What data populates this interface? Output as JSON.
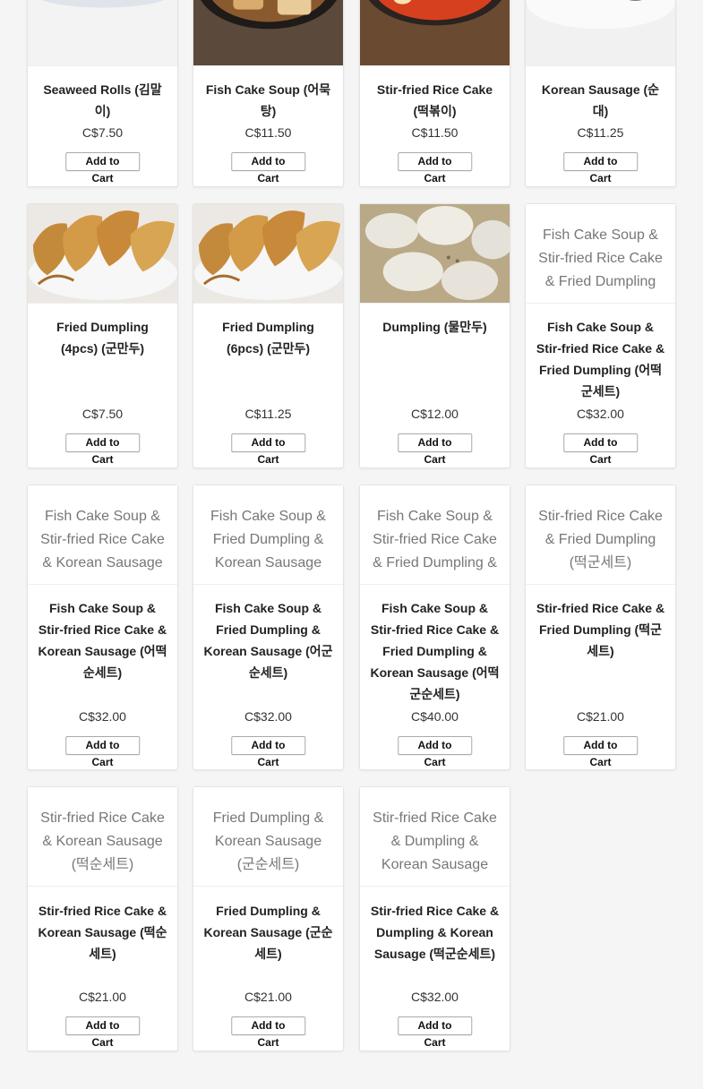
{
  "products": [
    {
      "name": "Seaweed Rolls (김말이)",
      "price": "C$7.50",
      "button": "Add to Cart",
      "image_alt": "",
      "image_kind": "seaweed"
    },
    {
      "name": "Fish Cake Soup (어묵탕)",
      "price": "C$11.50",
      "button": "Add to Cart",
      "image_alt": "",
      "image_kind": "soup"
    },
    {
      "name": "Stir-fried Rice Cake (떡볶이)",
      "price": "C$11.50",
      "button": "Add to Cart",
      "image_alt": "",
      "image_kind": "tteok"
    },
    {
      "name": "Korean Sausage (순대)",
      "price": "C$11.25",
      "button": "Add to Cart",
      "image_alt": "",
      "image_kind": "sausage"
    },
    {
      "name": "Fried Dumpling (4pcs) (군만두)",
      "price": "C$7.50",
      "button": "Add to Cart",
      "image_alt": "",
      "image_kind": "fried"
    },
    {
      "name": "Fried Dumpling (6pcs) (군만두)",
      "price": "C$11.25",
      "button": "Add to Cart",
      "image_alt": "",
      "image_kind": "fried"
    },
    {
      "name": "Dumpling (물만두)",
      "price": "C$12.00",
      "button": "Add to Cart",
      "image_alt": "",
      "image_kind": "steamed"
    },
    {
      "name": "Fish Cake Soup & Stir-fried Rice Cake & Fried Dumpling (어떡군세트)",
      "price": "C$32.00",
      "button": "Add to Cart",
      "image_alt": "Fish Cake Soup & Stir-fried Rice Cake & Fried Dumpling (어떡군세트)",
      "image_kind": "none"
    },
    {
      "name": "Fish Cake Soup & Stir-fried Rice Cake & Korean Sausage (어떡순세트)",
      "price": "C$32.00",
      "button": "Add to Cart",
      "image_alt": "Fish Cake Soup & Stir-fried Rice Cake & Korean Sausage (어떡순세트)",
      "image_kind": "none"
    },
    {
      "name": "Fish Cake Soup & Fried Dumpling & Korean Sausage (어군순세트)",
      "price": "C$32.00",
      "button": "Add to Cart",
      "image_alt": "Fish Cake Soup & Fried Dumpling & Korean Sausage (어군순세트)",
      "image_kind": "none"
    },
    {
      "name": "Fish Cake Soup & Stir-fried Rice Cake & Fried Dumpling & Korean Sausage (어떡군순세트)",
      "price": "C$40.00",
      "button": "Add to Cart",
      "image_alt": "Fish Cake Soup & Stir-fried Rice Cake & Fried Dumpling & Korean Sausage (어떡군순세트)",
      "image_kind": "none"
    },
    {
      "name": "Stir-fried Rice Cake & Fried Dumpling (떡군세트)",
      "price": "C$21.00",
      "button": "Add to Cart",
      "image_alt": "Stir-fried Rice Cake & Fried Dumpling (떡군세트)",
      "image_kind": "none"
    },
    {
      "name": "Stir-fried Rice Cake & Korean Sausage (떡순세트)",
      "price": "C$21.00",
      "button": "Add to Cart",
      "image_alt": "Stir-fried Rice Cake & Korean Sausage (떡순세트)",
      "image_kind": "none"
    },
    {
      "name": "Fried Dumpling & Korean Sausage (군순세트)",
      "price": "C$21.00",
      "button": "Add to Cart",
      "image_alt": "Fried Dumpling & Korean Sausage (군순세트)",
      "image_kind": "none"
    },
    {
      "name": "Stir-fried Rice Cake & Dumpling & Korean Sausage (떡군순세트)",
      "price": "C$32.00",
      "button": "Add to Cart",
      "image_alt": "Stir-fried Rice Cake & Dumpling & Korean Sausage (떡군순세트)",
      "image_kind": "none"
    }
  ]
}
